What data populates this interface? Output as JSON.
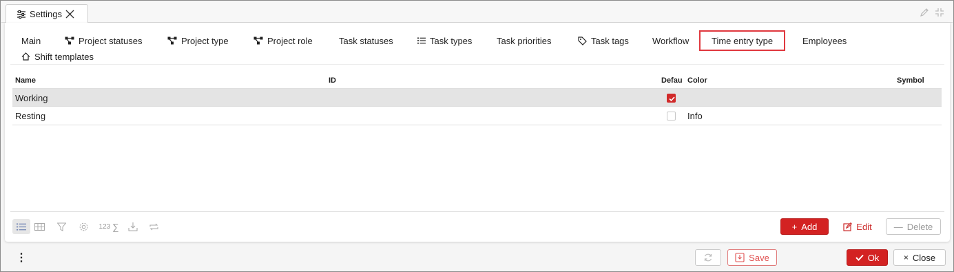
{
  "window": {
    "tab_title": "Settings"
  },
  "tabs": [
    {
      "label": "Main"
    },
    {
      "label": "Project statuses"
    },
    {
      "label": "Project type"
    },
    {
      "label": "Project role"
    },
    {
      "label": "Task statuses"
    },
    {
      "label": "Task types"
    },
    {
      "label": "Task priorities"
    },
    {
      "label": "Task tags"
    },
    {
      "label": "Workflow"
    },
    {
      "label": "Time entry type"
    },
    {
      "label": "Employees"
    },
    {
      "label": "Shift templates"
    }
  ],
  "active_tab": "Time entry type",
  "grid": {
    "columns": {
      "name": "Name",
      "id": "ID",
      "default": "Defau",
      "color": "Color",
      "symbol": "Symbol"
    },
    "rows": [
      {
        "name": "Working",
        "id": "",
        "default": true,
        "color": "",
        "symbol": ""
      },
      {
        "name": "Resting",
        "id": "",
        "default": false,
        "color": "Info",
        "symbol": ""
      }
    ]
  },
  "toolbar": {
    "sum_label": "123"
  },
  "grid_actions": {
    "add": "Add",
    "edit": "Edit",
    "delete": "Delete"
  },
  "footer": {
    "save": "Save",
    "ok": "Ok",
    "close": "Close"
  },
  "colors": {
    "accent": "#d32222",
    "active_tab_border": "#e0383e",
    "selected_row": "#e4e4e4"
  }
}
